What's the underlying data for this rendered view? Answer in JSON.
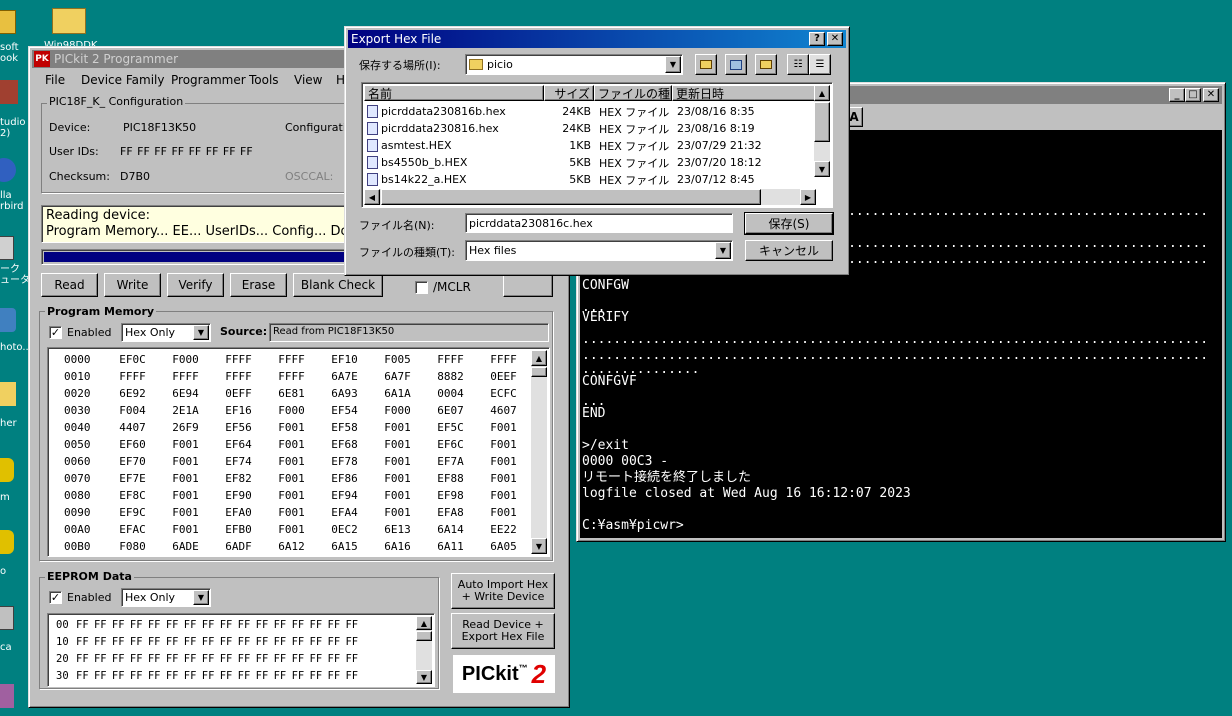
{
  "desktop_icons": [
    {
      "label": "soft",
      "label2": "ook"
    },
    {
      "label": "tudio",
      "label2": "2)"
    },
    {
      "label": "lla",
      "label2": "rbird"
    },
    {
      "label": "ーク",
      "label2": "ュータ"
    },
    {
      "label": "hoto.."
    },
    {
      "label": "her"
    },
    {
      "label": "m"
    },
    {
      "label": "o"
    },
    {
      "label": "ca"
    }
  ],
  "desktop_folder_label": "Win98DDK",
  "pickit": {
    "title": "PICkit 2 Programmer",
    "menu": [
      "File",
      "Device Family",
      "Programmer",
      "Tools",
      "View",
      "H"
    ],
    "config_group": "PIC18F_K_ Configuration",
    "device_label": "Device:",
    "device_value": "PIC18F13K50",
    "config_label": "Configuratio",
    "userid_label": "User IDs:",
    "userid_value": "FF FF FF FF FF FF FF FF",
    "checksum_label": "Checksum:",
    "checksum_value": "D7B0",
    "osccal_label": "OSCCAL:",
    "status_line1": "Reading device:",
    "status_line2": "Program Memory... EE... UserIDs... Config... Do",
    "progress": 1.0,
    "buttons": [
      "Read",
      "Write",
      "Verify",
      "Erase",
      "Blank Check"
    ],
    "mclr_label": "/MCLR",
    "pm": {
      "group": "Program Memory",
      "enabled_label": "Enabled",
      "mode": "Hex Only",
      "source_label": "Source:",
      "source_value": "Read from PIC18F13K50",
      "rows": [
        {
          "addr": "0000",
          "vals": [
            "EF0C",
            "F000",
            "FFFF",
            "FFFF",
            "EF10",
            "F005",
            "FFFF",
            "FFFF"
          ]
        },
        {
          "addr": "0010",
          "vals": [
            "FFFF",
            "FFFF",
            "FFFF",
            "FFFF",
            "6A7E",
            "6A7F",
            "8882",
            "0EEF"
          ]
        },
        {
          "addr": "0020",
          "vals": [
            "6E92",
            "6E94",
            "0EFF",
            "6E81",
            "6A93",
            "6A1A",
            "0004",
            "ECFC"
          ]
        },
        {
          "addr": "0030",
          "vals": [
            "F004",
            "2E1A",
            "EF16",
            "F000",
            "EF54",
            "F000",
            "6E07",
            "4607"
          ]
        },
        {
          "addr": "0040",
          "vals": [
            "4407",
            "26F9",
            "EF56",
            "F001",
            "EF58",
            "F001",
            "EF5C",
            "F001"
          ]
        },
        {
          "addr": "0050",
          "vals": [
            "EF60",
            "F001",
            "EF64",
            "F001",
            "EF68",
            "F001",
            "EF6C",
            "F001"
          ]
        },
        {
          "addr": "0060",
          "vals": [
            "EF70",
            "F001",
            "EF74",
            "F001",
            "EF78",
            "F001",
            "EF7A",
            "F001"
          ]
        },
        {
          "addr": "0070",
          "vals": [
            "EF7E",
            "F001",
            "EF82",
            "F001",
            "EF86",
            "F001",
            "EF88",
            "F001"
          ]
        },
        {
          "addr": "0080",
          "vals": [
            "EF8C",
            "F001",
            "EF90",
            "F001",
            "EF94",
            "F001",
            "EF98",
            "F001"
          ]
        },
        {
          "addr": "0090",
          "vals": [
            "EF9C",
            "F001",
            "EFA0",
            "F001",
            "EFA4",
            "F001",
            "EFA8",
            "F001"
          ]
        },
        {
          "addr": "00A0",
          "vals": [
            "EFAC",
            "F001",
            "EFB0",
            "F001",
            "0EC2",
            "6E13",
            "6A14",
            "EE22"
          ]
        },
        {
          "addr": "00B0",
          "vals": [
            "F080",
            "6ADE",
            "6ADF",
            "6A12",
            "6A15",
            "6A16",
            "6A11",
            "6A05"
          ]
        }
      ]
    },
    "ee": {
      "group": "EEPROM Data",
      "enabled_label": "Enabled",
      "mode": "Hex Only",
      "rows": [
        {
          "addr": "00",
          "vals": "FF FF FF FF FF FF FF FF FF FF FF FF FF FF FF FF"
        },
        {
          "addr": "10",
          "vals": "FF FF FF FF FF FF FF FF FF FF FF FF FF FF FF FF"
        },
        {
          "addr": "20",
          "vals": "FF FF FF FF FF FF FF FF FF FF FF FF FF FF FF FF"
        },
        {
          "addr": "30",
          "vals": "FF FF FF FF FF FF FF FF FF FF FF FF FF FF FF FF"
        }
      ]
    },
    "auto_import_l1": "Auto Import Hex",
    "auto_import_l2": "+ Write Device",
    "read_export_l1": "Read Device +",
    "read_export_l2": "Export Hex File",
    "logo_text": "PICkit",
    "logo_tm": "™",
    "logo_num": "2"
  },
  "terminal": {
    "lines": [
      {
        "t": "CONFGW"
      },
      {
        "t": "..."
      },
      {
        "t": "VERIFY"
      },
      {
        "t": "................................................................................"
      },
      {
        "t": "................................................................................"
      },
      {
        "t": "..............."
      },
      {
        "t": "CONFGVF"
      },
      {
        "t": "..."
      },
      {
        "t": "END"
      },
      {
        "t": ""
      },
      {
        "t": ">/exit"
      },
      {
        "t": "0000 00C3 -"
      },
      {
        "t": "リモート接続を終了しました"
      },
      {
        "t": "logfile closed at Wed Aug 16 16:12:07 2023"
      },
      {
        "t": ""
      },
      {
        "t": "C:¥asm¥picwr>"
      }
    ],
    "dots_top": "................................................................................"
  },
  "dialog": {
    "title": "Export Hex File",
    "look_in_label": "保存する場所(I):",
    "look_in_value": "picio",
    "columns": [
      "名前",
      "サイズ",
      "ファイルの種...",
      "更新日時"
    ],
    "files": [
      {
        "name": "picrddata230816b.hex",
        "size": "24KB",
        "type": "HEX ファイル",
        "date": "23/08/16 8:35"
      },
      {
        "name": "picrddata230816.hex",
        "size": "24KB",
        "type": "HEX ファイル",
        "date": "23/08/16 8:19"
      },
      {
        "name": "asmtest.HEX",
        "size": "1KB",
        "type": "HEX ファイル",
        "date": "23/07/29 21:32"
      },
      {
        "name": "bs4550b_b.HEX",
        "size": "5KB",
        "type": "HEX ファイル",
        "date": "23/07/20 18:12"
      },
      {
        "name": "bs14k22_a.HEX",
        "size": "5KB",
        "type": "HEX ファイル",
        "date": "23/07/12 8:45"
      }
    ],
    "filename_label": "ファイル名(N):",
    "filename_value": "picrddata230816c.hex",
    "filetype_label": "ファイルの種類(T):",
    "filetype_value": "Hex files",
    "save_label": "保存(S)",
    "cancel_label": "キャンセル"
  }
}
